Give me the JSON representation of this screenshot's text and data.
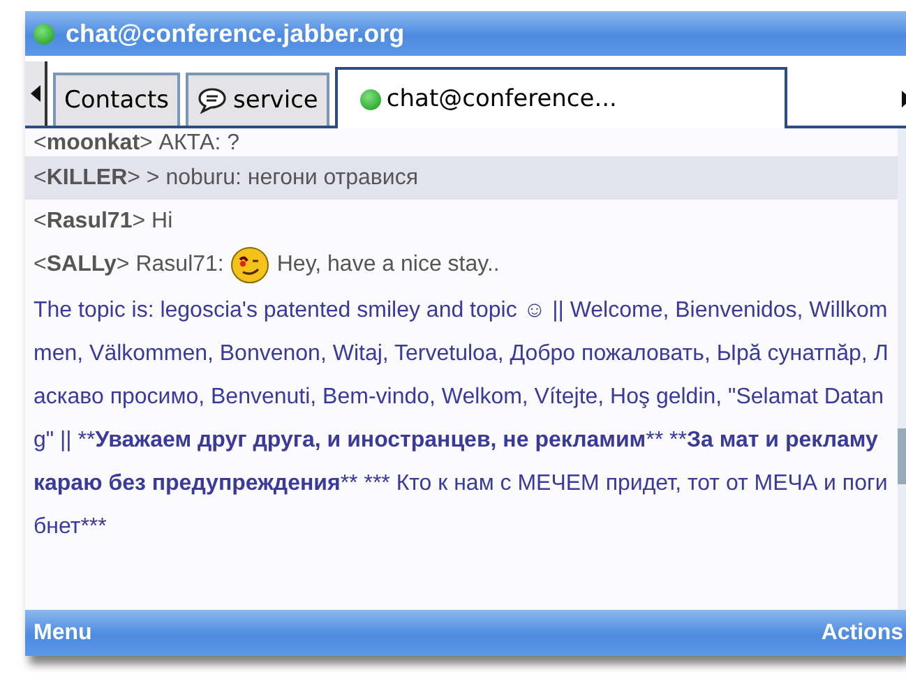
{
  "window": {
    "title": "chat@conference.jabber.org",
    "online": true
  },
  "tabs": [
    {
      "label": "Contacts",
      "kind": "plain",
      "selected": false
    },
    {
      "label": "service",
      "kind": "bubble",
      "selected": false
    },
    {
      "label": "chat@conference...",
      "kind": "status",
      "selected": true
    }
  ],
  "messages": [
    {
      "kind": "text",
      "line": "<**moonkat**> АКТА: ?",
      "selected": false
    },
    {
      "kind": "text",
      "line": "<**KILLER**> > noburu: негони отравися",
      "selected": true
    },
    {
      "kind": "text",
      "line": "<**Rasul71**> Hi",
      "selected": false
    },
    {
      "kind": "smiley",
      "line": "<**SALLy**> Rasul71:",
      "after": "Hey, have a nice stay..",
      "selected": false
    }
  ],
  "topic": [
    {
      "text": "The topic is: legoscia's patented smiley and topic ☺ || Welcome, Bienvenidos, Willkommen, Välkommen, Bonvenon, Witaj, Tervetuloa, Добро пожаловать, Ырă сунатпăр, Ласкаво просимо, Benvenuti, Bem-vindo, Welkom, Vítejte, Hoş geldin, \"Selamat Datang\" || **",
      "bold": false
    },
    {
      "text": "Уважаем друг друга, и иностранцев, не рекламим",
      "bold": true
    },
    {
      "text": "** **",
      "bold": false
    },
    {
      "text": "За мат и рекламу караю без предупреждения",
      "bold": true
    },
    {
      "text": "** *** Кто к нам с МЕЧЕМ придет, тот от МЕЧА и погибнет***",
      "bold": false
    }
  ],
  "softkeys": {
    "left": "Menu",
    "right": "Actions"
  }
}
